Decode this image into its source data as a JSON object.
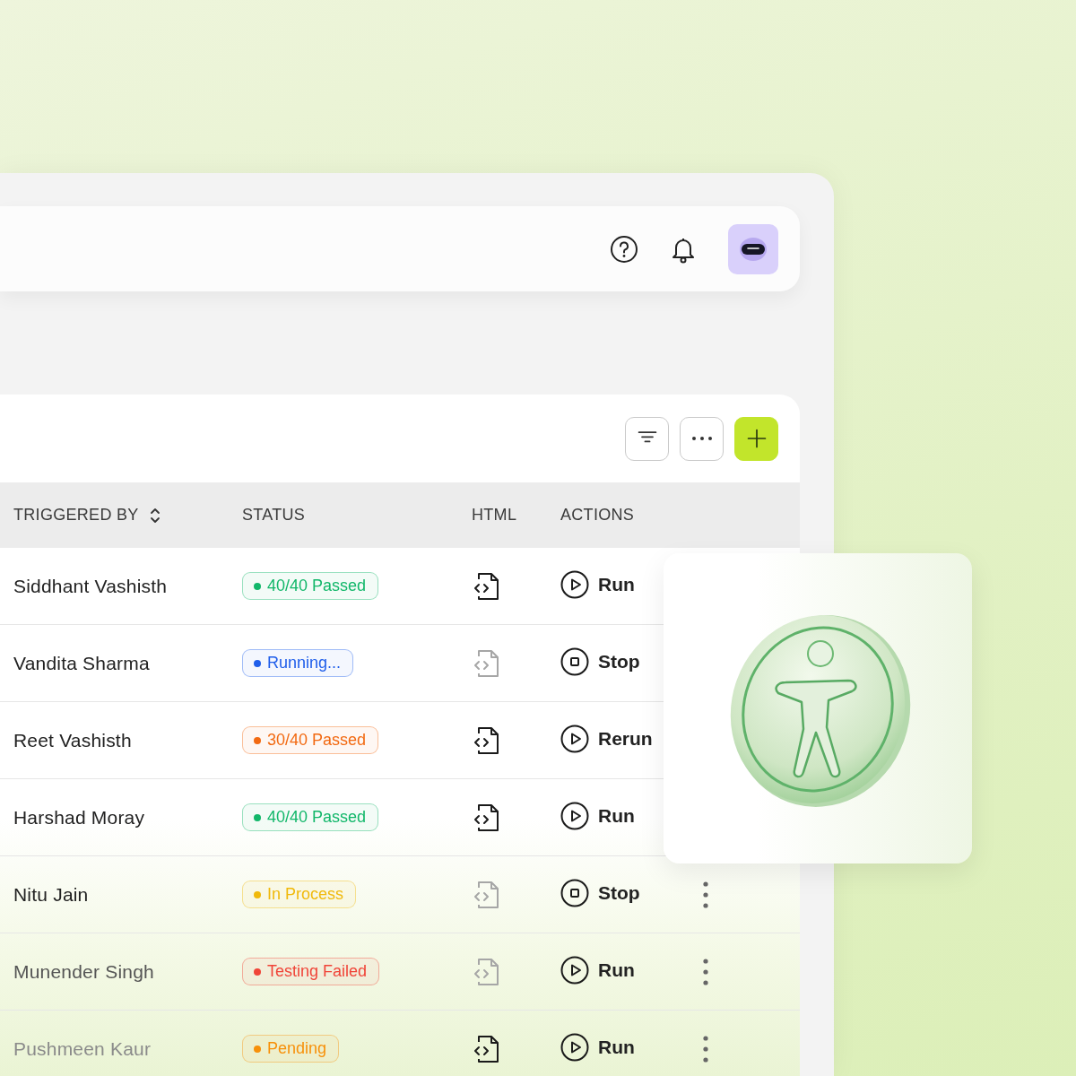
{
  "header": {
    "buttons": [
      {
        "kind": "help"
      },
      {
        "kind": "notifications"
      },
      {
        "kind": "avatar"
      }
    ]
  },
  "toolbar": {
    "buttons": [
      {
        "kind": "filter"
      },
      {
        "kind": "more"
      },
      {
        "kind": "add"
      }
    ]
  },
  "table": {
    "columns": [
      {
        "label": "TRIGGERED BY",
        "sortable": true
      },
      {
        "label": "STATUS"
      },
      {
        "label": "HTML"
      },
      {
        "label": "ACTIONS"
      }
    ],
    "rows": [
      {
        "triggered_by": "Siddhant Vashisth",
        "status": "40/40 Passed",
        "color": "#12b76a",
        "html_available": true,
        "action": {
          "kind": "run",
          "label": "Run"
        },
        "menu": false
      },
      {
        "triggered_by": "Vandita Sharma",
        "status": "Running...",
        "color": "#1f5eea",
        "html_available": false,
        "action": {
          "kind": "stop",
          "label": "Stop"
        },
        "menu": false
      },
      {
        "triggered_by": "Reet Vashisth",
        "status": "30/40 Passed",
        "color": "#f26a12",
        "html_available": true,
        "action": {
          "kind": "run",
          "label": "Rerun"
        },
        "menu": false
      },
      {
        "triggered_by": "Harshad Moray",
        "status": "40/40 Passed",
        "color": "#12b76a",
        "html_available": true,
        "action": {
          "kind": "run",
          "label": "Run"
        },
        "menu": false
      },
      {
        "triggered_by": "Nitu Jain",
        "status": "In Process",
        "color": "#f0b90b",
        "html_available": false,
        "action": {
          "kind": "stop",
          "label": "Stop"
        },
        "menu": true
      },
      {
        "triggered_by": "Munender Singh",
        "status": "Testing Failed",
        "color": "#f04438",
        "html_available": false,
        "action": {
          "kind": "run",
          "label": "Run"
        },
        "menu": true
      },
      {
        "triggered_by": "Pushmeen Kaur",
        "status": "Pending",
        "color": "#f79009",
        "html_available": true,
        "action": {
          "kind": "run",
          "label": "Run"
        },
        "menu": true
      }
    ]
  }
}
